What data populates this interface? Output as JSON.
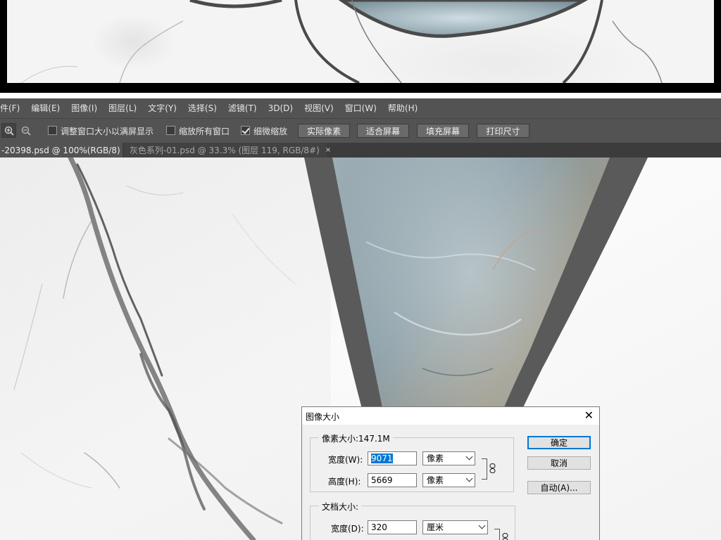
{
  "menu": [
    "件(F)",
    "编辑(E)",
    "图像(I)",
    "图层(L)",
    "文字(Y)",
    "选择(S)",
    "滤镜(T)",
    "3D(D)",
    "视图(V)",
    "窗口(W)",
    "帮助(H)"
  ],
  "options": {
    "zoom_in_icon": "zoom-in",
    "zoom_out_icon": "zoom-out",
    "resize_windows_label": "调整窗口大小以满屏显示",
    "zoom_all_windows_label": "缩放所有窗口",
    "scrubby_zoom_label": "细微缩放",
    "actual_pixels_label": "实际像素",
    "fit_screen_label": "适合屏幕",
    "fill_screen_label": "填充屏幕",
    "print_size_label": "打印尺寸",
    "resize_windows_checked": false,
    "zoom_all_windows_checked": false,
    "scrubby_zoom_checked": true
  },
  "tabs": [
    {
      "label": "-20398.psd @ 100%(RGB/8)",
      "close": "×",
      "active": true
    },
    {
      "label": "灰色系列-01.psd @ 33.3% (图层 119, RGB/8#)",
      "close": "×",
      "active": false
    }
  ],
  "dialog": {
    "title": "图像大小",
    "close": "✕",
    "pixel_group_label": "像素大小:147.1M",
    "pixel_width_label": "宽度(W):",
    "pixel_width_value": "9071",
    "pixel_width_unit": "像素",
    "pixel_height_label": "高度(H):",
    "pixel_height_value": "5669",
    "pixel_height_unit": "像素",
    "doc_group_label": "文档大小:",
    "doc_width_label": "宽度(D):",
    "doc_width_value": "320",
    "doc_width_unit": "厘米",
    "ok_label": "确定",
    "cancel_label": "取消",
    "auto_label": "自动(A)..."
  },
  "colors": {
    "ui_dark": "#535353",
    "tab_bar": "#3c3c3c",
    "frame_gray": "#5a5a5a",
    "marble_blue": "#8fa3ad",
    "dialog_bg": "#f0f0f0",
    "selection_blue": "#0078d7"
  }
}
